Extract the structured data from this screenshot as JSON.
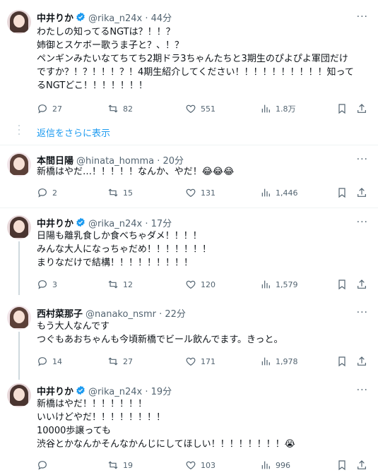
{
  "tweets": [
    {
      "name": "中井りか",
      "verified": true,
      "handle": "@rika_n24x · 44分",
      "text": "わたしの知ってるNGTは？！！？\n姉御とスケボー歌うま子と？、！？\nペンギンみたいなてちてち2期ドラ3ちゃんたちと3期生のぴよぴよ軍団だけ\nですか？！？！！！？！4期生紹介してください！！！！！！！！！！知って\nるNGTどこ！！！！！！！",
      "reply": "27",
      "retweet": "82",
      "like": "551",
      "views": "1.8万"
    },
    {
      "name": "本間日陽",
      "verified": false,
      "handle": "@hinata_homma · 20分",
      "text": "新橋はやだ…！！！！！なんか、やだ！😂😂😂",
      "reply": "2",
      "retweet": "15",
      "like": "131",
      "views": "1,446"
    },
    {
      "name": "中井りか",
      "verified": true,
      "handle": "@rika_n24x · 17分",
      "text": "日陽も離乳食しか食べちゃダメ！！！！\nみんな大人になっちゃだめ！！！！！！！\nまりなだけで結構！！！！！！！！！",
      "reply": "3",
      "retweet": "12",
      "like": "120",
      "views": "1,579"
    },
    {
      "name": "西村菜那子",
      "verified": false,
      "handle": "@nanako_nsmr · 22分",
      "text": "もう大人なんです\nつぐもあおちゃんも今頃新橋でビール飲んでます。きっと。",
      "reply": "14",
      "retweet": "27",
      "like": "171",
      "views": "1,978"
    },
    {
      "name": "中井りか",
      "verified": true,
      "handle": "@rika_n24x · 19分",
      "text": "新橋はやだ！！！！！！！\nいいけどやだ！！！！！！！！\n10000歩譲っても\n渋谷とかなんかそんなかんじにしてほしい！！！！！！！！😭",
      "reply": "",
      "retweet": "19",
      "like": "103",
      "views": "996"
    }
  ],
  "show_more_replies": "返信をさらに表示",
  "more_glyph": "···",
  "colors": {
    "accent": "#1d9bf0",
    "text": "#0f1419",
    "muted": "#536471",
    "line": "#cfd9de"
  }
}
